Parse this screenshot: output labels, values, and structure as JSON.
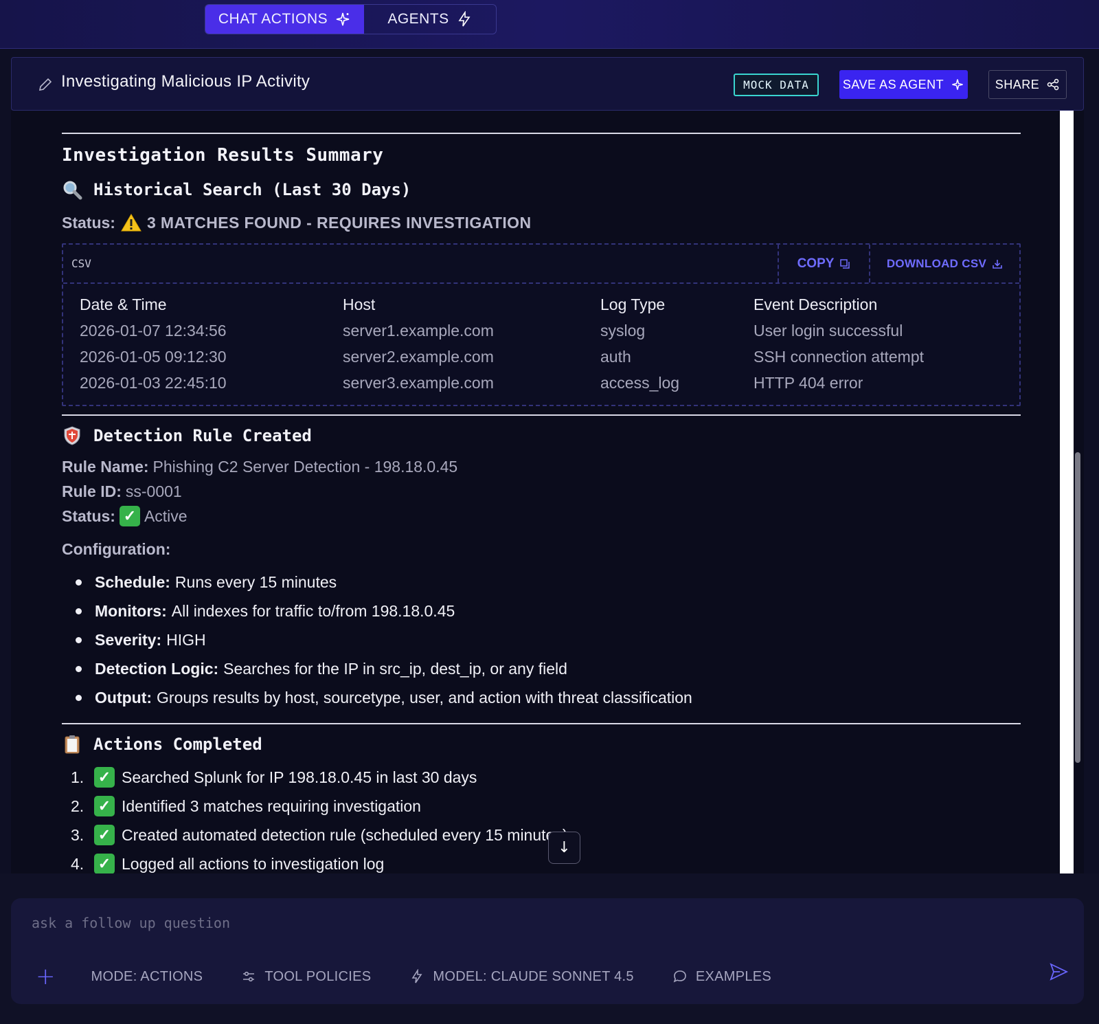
{
  "tabs": [
    {
      "label": "CHAT ACTIONS",
      "active": true,
      "icon": "sparkle-icon"
    },
    {
      "label": "AGENTS",
      "active": false,
      "icon": "bolt-icon"
    }
  ],
  "header": {
    "title": "Investigating Malicious IP Activity",
    "mock_badge": "MOCK DATA",
    "save_label": "SAVE AS AGENT",
    "share_label": "SHARE"
  },
  "content": {
    "summary_title": "Investigation Results Summary",
    "historical": {
      "heading": "Historical Search (Last 30 Days)",
      "status_label": "Status:",
      "status_value": "3 MATCHES FOUND - REQUIRES INVESTIGATION"
    },
    "csv": {
      "label": "CSV",
      "copy_label": "COPY",
      "download_label": "DOWNLOAD CSV",
      "columns": [
        "Date & Time",
        "Host",
        "Log Type",
        "Event Description"
      ],
      "rows": [
        [
          "2026-01-07 12:34:56",
          "server1.example.com",
          "syslog",
          "User login successful"
        ],
        [
          "2026-01-05 09:12:30",
          "server2.example.com",
          "auth",
          "SSH connection attempt"
        ],
        [
          "2026-01-03 22:45:10",
          "server3.example.com",
          "access_log",
          "HTTP 404 error"
        ]
      ]
    },
    "rule": {
      "heading": "Detection Rule Created",
      "name_label": "Rule Name:",
      "name_value": "Phishing C2 Server Detection - 198.18.0.45",
      "id_label": "Rule ID:",
      "id_value": "ss-0001",
      "status_label": "Status:",
      "status_value": "Active",
      "config_label": "Configuration:",
      "config": [
        {
          "label": "Schedule:",
          "value": "Runs every 15 minutes"
        },
        {
          "label": "Monitors:",
          "value": "All indexes for traffic to/from 198.18.0.45"
        },
        {
          "label": "Severity:",
          "value": "HIGH"
        },
        {
          "label": "Detection Logic:",
          "value": "Searches for the IP in src_ip, dest_ip, or any field"
        },
        {
          "label": "Output:",
          "value": "Groups results by host, sourcetype, user, and action with threat classification"
        }
      ]
    },
    "actions": {
      "heading": "Actions Completed",
      "items": [
        {
          "num": "1.",
          "text": "Searched Splunk for IP 198.18.0.45 in last 30 days"
        },
        {
          "num": "2.",
          "text": "Identified 3 matches requiring investigation"
        },
        {
          "num": "3.",
          "text": "Created automated detection rule (scheduled every 15 minutes)"
        },
        {
          "num": "4.",
          "text": "Logged all actions to investigation log"
        }
      ]
    }
  },
  "composer": {
    "placeholder": "ask a follow up question",
    "mode": "MODE: ACTIONS",
    "tool_policies": "TOOL POLICIES",
    "model": "MODEL: CLAUDE SONNET 4.5",
    "examples": "EXAMPLES"
  },
  "colors": {
    "accent": "#3a24f0",
    "link": "#6f6cff",
    "badge_border": "#3ad6d0",
    "check_green": "#36b24a",
    "warning_yellow": "#f4c21b"
  }
}
